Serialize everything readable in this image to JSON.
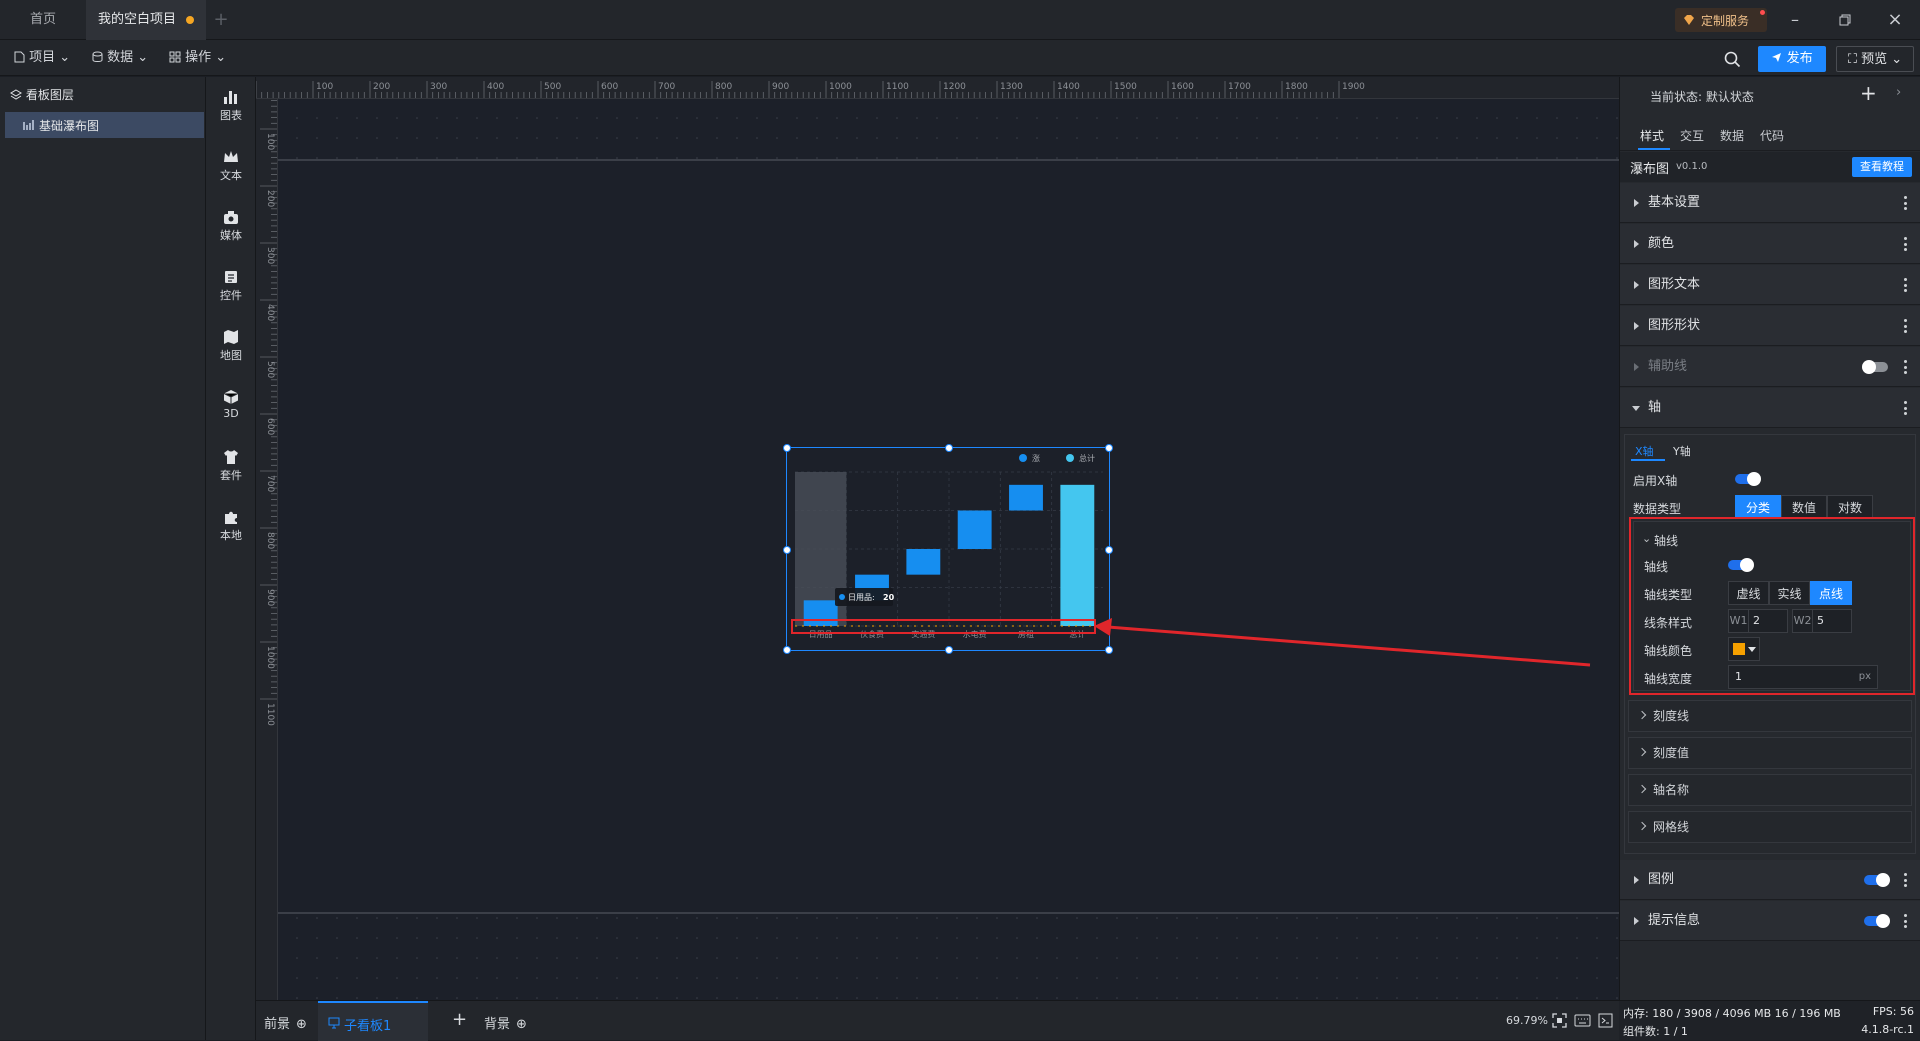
{
  "tabs": {
    "home": "首页",
    "project": "我的空白项目"
  },
  "titlebar": {
    "custom_service": "定制服务"
  },
  "menubar": {
    "project": "项目",
    "data": "数据",
    "operate": "操作",
    "publish": "发布",
    "preview": "预览"
  },
  "layers": {
    "title": "看板图层",
    "item": "基础瀑布图"
  },
  "iconbar": [
    "图表",
    "文本",
    "媒体",
    "控件",
    "地图",
    "3D",
    "套件",
    "本地"
  ],
  "ruler": {
    "top": [
      "100",
      "200",
      "300",
      "400",
      "500",
      "600",
      "700",
      "800",
      "900",
      "1000",
      "1100",
      "1200",
      "1300",
      "1400",
      "1500",
      "1600",
      "1700",
      "1800",
      "1900"
    ],
    "left": [
      "100",
      "200",
      "300",
      "400",
      "500",
      "600",
      "700",
      "800",
      "900",
      "1000",
      "1100"
    ]
  },
  "chart_data": {
    "type": "bar",
    "categories": [
      "日用品",
      "伙食费",
      "交通费",
      "水电费",
      "房租",
      "总计"
    ],
    "legend": [
      "涨",
      "总计"
    ],
    "bases": [
      0,
      20,
      40,
      60,
      90,
      0
    ],
    "values": [
      20,
      20,
      20,
      30,
      20,
      110
    ],
    "ylim": [
      0,
      120
    ],
    "tooltip": {
      "label": "日用品:",
      "value": "20"
    },
    "colors": {
      "rise": "#168ef0",
      "total": "#44c6ef",
      "highlight": "#4a4f59"
    }
  },
  "bottombar": {
    "front": "前景",
    "board": "子看板1",
    "back": "背景",
    "zoom": "69.79%"
  },
  "status": {
    "memory_label": "内存:",
    "memory": "180 / 3908 / 4096 MB 16 / 196 MB",
    "fps_label": "FPS:",
    "fps": "56",
    "components_label": "组件数:",
    "components": "1 / 1",
    "version": "4.1.8-rc.1"
  },
  "rpanel": {
    "state_label": "当前状态:",
    "state_value": "默认状态",
    "tabs": [
      "样式",
      "交互",
      "数据",
      "代码"
    ],
    "widget_name": "瀑布图",
    "widget_version": "v0.1.0",
    "tutorial": "查看教程",
    "sections": [
      "基本设置",
      "颜色",
      "图形文本",
      "图形形状",
      "辅助线",
      "轴"
    ],
    "axis_tabs": [
      "X轴",
      "Y轴"
    ],
    "enable_x": "启用X轴",
    "data_type_label": "数据类型",
    "data_types": [
      "分类",
      "数值",
      "对数"
    ],
    "axis_line": {
      "title": "轴线",
      "line_label": "轴线",
      "type_label": "轴线类型",
      "types": [
        "虚线",
        "实线",
        "点线"
      ],
      "style_label": "线条样式",
      "w1_label": "W1",
      "w1": "2",
      "w2_label": "W2",
      "w2": "5",
      "color_label": "轴线颜色",
      "color": "#f5a000",
      "width_label": "轴线宽度",
      "width": "1",
      "width_unit": "px"
    },
    "sub_sections": [
      "刻度线",
      "刻度值",
      "轴名称",
      "网格线"
    ],
    "bottom_sections": [
      "图例",
      "提示信息"
    ]
  }
}
